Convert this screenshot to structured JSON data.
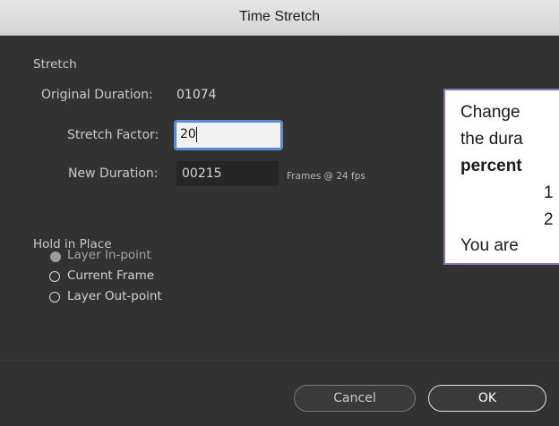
{
  "window": {
    "title": "Time Stretch"
  },
  "stretch": {
    "section_label": "Stretch",
    "original_duration_label": "Original Duration:",
    "original_duration_value": "01074",
    "stretch_factor_label": "Stretch Factor:",
    "stretch_factor_value": "20",
    "new_duration_label": "New Duration:",
    "new_duration_value": "00215",
    "frames_note": "Frames @ 24 fps"
  },
  "hold": {
    "section_label": "Hold in Place",
    "options": [
      {
        "label": "Layer In-point",
        "selected": true
      },
      {
        "label": "Current Frame",
        "selected": false
      },
      {
        "label": "Layer Out-point",
        "selected": false
      }
    ]
  },
  "buttons": {
    "cancel": "Cancel",
    "ok": "OK"
  },
  "callout": {
    "line1": "Change",
    "line2": "the dura",
    "line3": "percent",
    "line4": "1",
    "line5": "2",
    "line6": "You are"
  },
  "colors": {
    "panel_bg": "#323232",
    "focus_ring": "#5d8fd8",
    "callout_border": "#8b6fb8"
  }
}
